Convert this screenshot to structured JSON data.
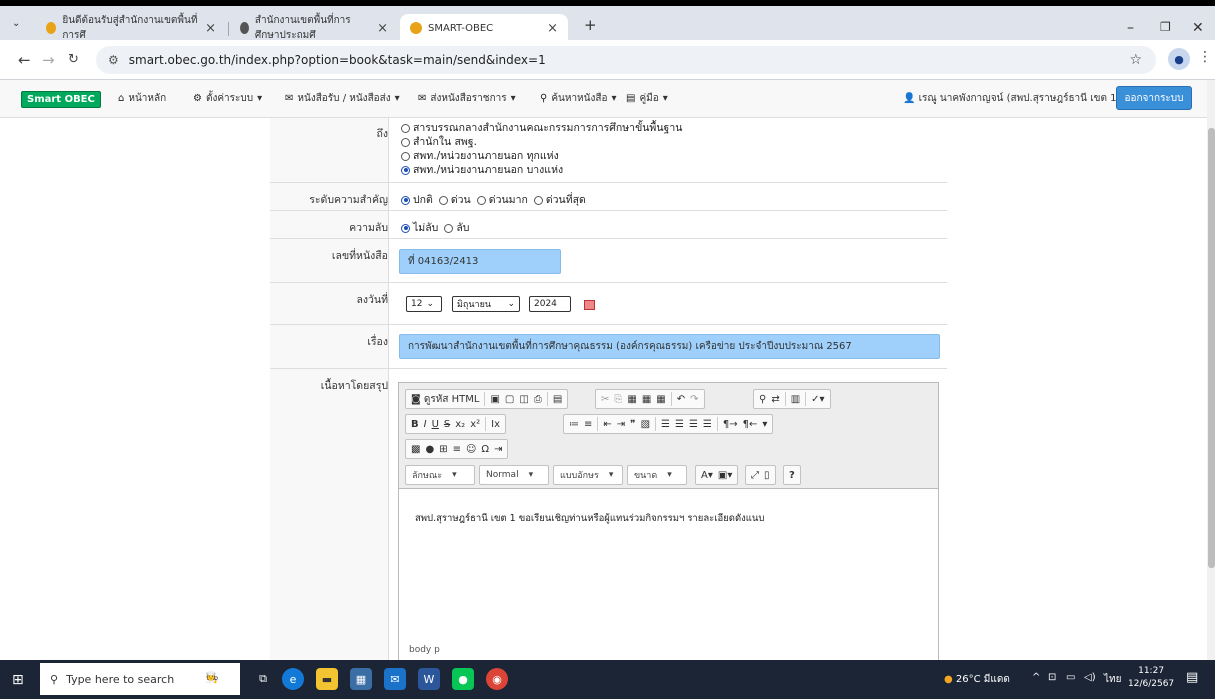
{
  "browser": {
    "tabs": [
      {
        "title": "ยินดีต้อนรับสู่สำนักงานเขตพื้นที่การศึ"
      },
      {
        "title": "สำนักงานเขตพื้นที่การศึกษาประถมศึ"
      },
      {
        "title": "SMART-OBEC"
      }
    ],
    "new_tab": "+",
    "address": "smart.obec.go.th/index.php?option=book&task=main/send&index=1"
  },
  "navbar": {
    "brand": "Smart OBEC",
    "items": [
      "หน้าหลัก",
      "ตั้งค่าระบบ",
      "หนังสือรับ / หนังสือส่ง",
      "ส่งหนังสือราชการ",
      "ค้นหาหนังสือ",
      "คู่มือ"
    ],
    "user": "เรณู นาคพังกาญจน์ (สพป.สุราษฎร์ธานี เขต 1)",
    "logout": "ออกจากระบบ"
  },
  "form": {
    "to_label": "ถึง",
    "to_options": [
      "สารบรรณกลางสำนักงานคณะกรรมการการศึกษาขั้นพื้นฐาน",
      "สำนักใน สพฐ.",
      "สพท./หน่วยงานภายนอก ทุกแห่ง",
      "สพท./หน่วยงานภายนอก บางแห่ง"
    ],
    "to_selected": 3,
    "priority_label": "ระดับความสำคัญ",
    "priority_options": [
      "ปกติ",
      "ด่วน",
      "ด่วนมาก",
      "ด่วนที่สุด"
    ],
    "priority_selected": 0,
    "secret_label": "ความลับ",
    "secret_options": [
      "ไม่ลับ",
      "ลับ"
    ],
    "secret_selected": 0,
    "docno_label": "เลขที่หนังสือ",
    "docno_value": "ที่ 04163/2413",
    "date_label": "ลงวันที่",
    "date_day": "12",
    "date_month": "มิถุนายน",
    "date_year": "2024",
    "subject_label": "เรื่อง",
    "subject_value": "การพัฒนาสำนักงานเขตพื้นที่การศึกษาคุณธรรม (องค์กรคุณธรรม) เครือข่าย ประจำปีงบประมาณ 2567",
    "summary_label": "เนื้อหาโดยสรุป"
  },
  "editor": {
    "source_label": "ดูรหัส HTML",
    "style_combo": "ลักษณะ",
    "format_combo": "Normal",
    "font_combo": "แบบอักษร",
    "size_combo": "ขนาด",
    "help": "?",
    "body_text": "สพป.สุราษฎร์ธานี เขต 1 ขอเรียนเชิญท่านหรือผู้แทนร่วมกิจกรรมฯ รายละเอียดดังแนบ",
    "path": "body  p"
  },
  "taskbar": {
    "search_placeholder": "Type here to search",
    "weather": "26°C มีแดด",
    "lang": "ไทย",
    "time": "11:27",
    "date": "12/6/2567"
  }
}
